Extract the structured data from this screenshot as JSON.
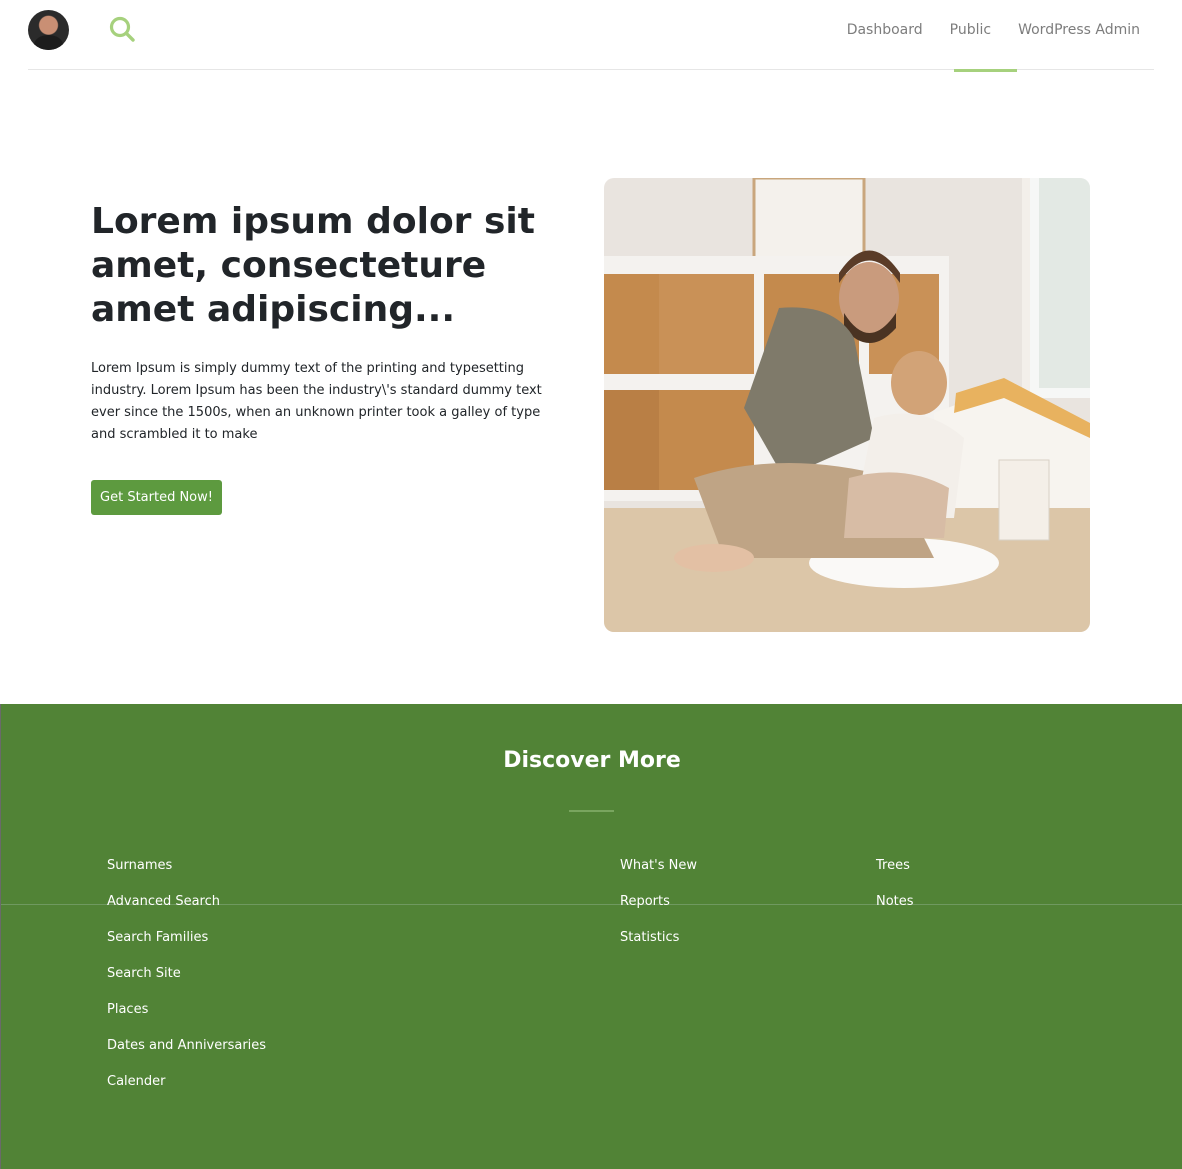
{
  "header": {
    "nav": [
      "Dashboard",
      "Public",
      "WordPress Admin"
    ],
    "active_nav": "Public",
    "icons": {
      "avatar": "user-avatar",
      "search": "search-icon"
    },
    "accent_color": "#a6d17d"
  },
  "hero": {
    "title": "Lorem ipsum dolor sit amet, consecteture amet adipiscing...",
    "text": "Lorem Ipsum is simply dummy text of the printing and typesetting industry. Lorem Ipsum has been the industry\\'s standard dummy text ever since the 1500s, when an unknown printer took a galley of type and scrambled it to make",
    "cta_label": "Get Started Now!",
    "cta_color": "#5d9a3f"
  },
  "discover": {
    "title": "Discover More",
    "background": "#518336",
    "column1": [
      "Surnames",
      "Advanced Search",
      "Search Families",
      "Search Site",
      "Places",
      "Dates and Anniversaries",
      "Calender"
    ],
    "column2": [
      "What's New",
      "Reports",
      "Statistics"
    ],
    "column3": [
      "Trees",
      "Notes"
    ]
  }
}
